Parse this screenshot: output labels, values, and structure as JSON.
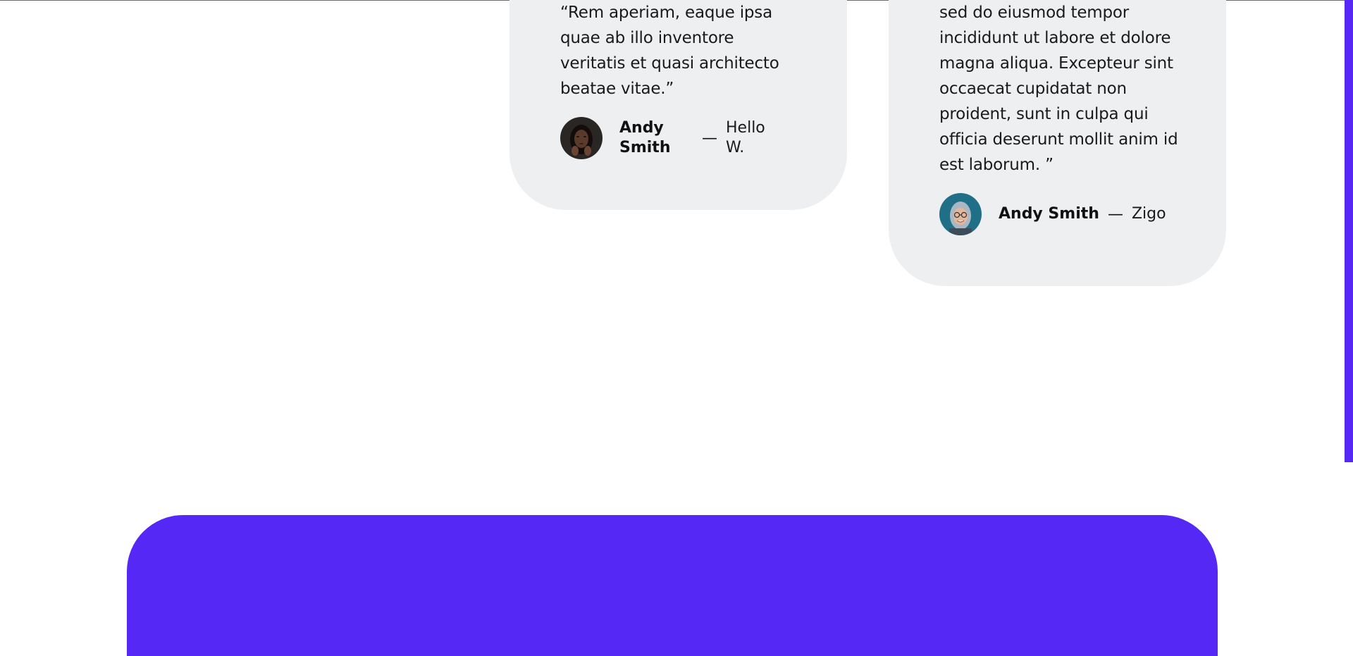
{
  "testimonials": [
    {
      "quote": "“Rem aperiam, eaque ipsa quae ab illo inventore veritatis et quasi architecto beatae vitae.”",
      "author_name": "Andy Smith",
      "separator": "—",
      "company": "Hello W.",
      "avatar_icon": "woman-portrait-avatar"
    },
    {
      "quote": "sed do eiusmod tempor incididunt ut labore et dolore magna aliqua. Excepteur sint occaecat cupidatat non proident, sunt in culpa qui officia deserunt mollit anim id est laborum. ”",
      "author_name": "Andy Smith",
      "separator": "—",
      "company": "Zigo",
      "avatar_icon": "woman-with-glasses-avatar"
    }
  ],
  "colors": {
    "accent": "#5528F5",
    "card_background": "#EEEFF1",
    "page_background": "#FFFFFF"
  }
}
